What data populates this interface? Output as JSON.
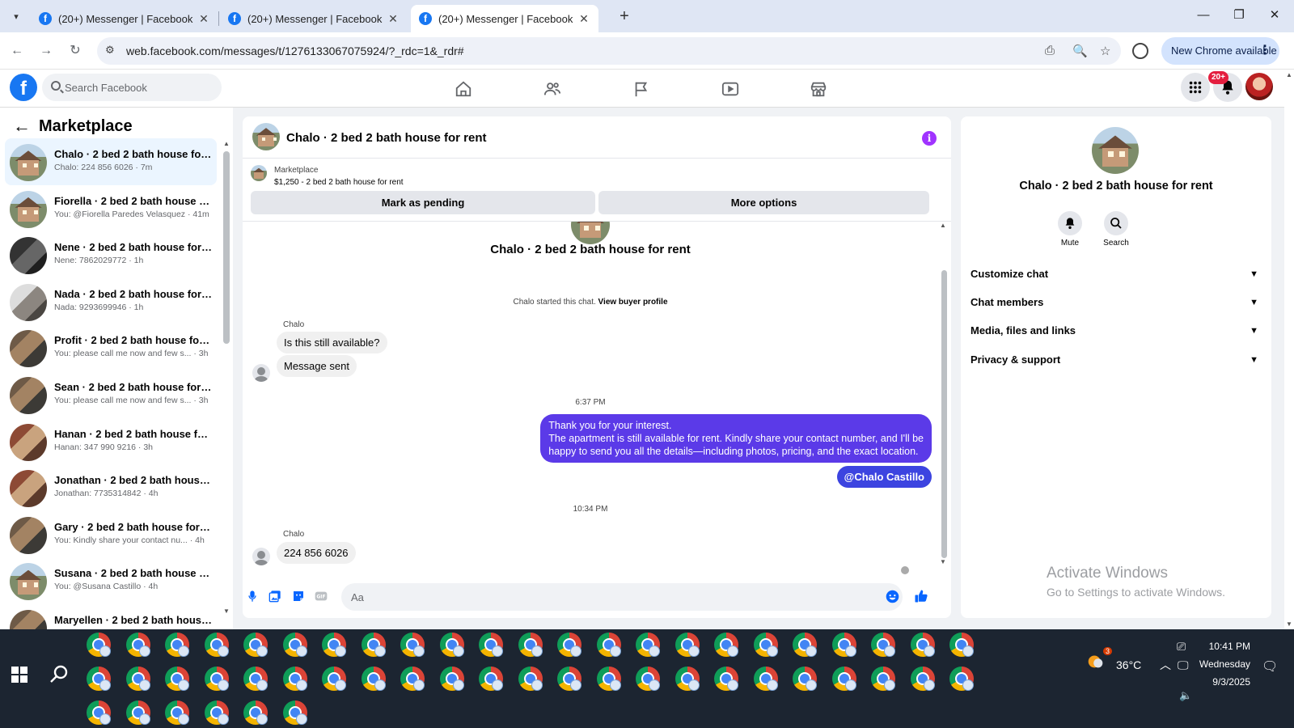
{
  "browser": {
    "tabs": [
      {
        "title": "(20+) Messenger | Facebook",
        "active": false
      },
      {
        "title": "(20+) Messenger | Facebook",
        "active": false
      },
      {
        "title": "(20+) Messenger | Facebook",
        "active": true
      }
    ],
    "url": "web.facebook.com/messages/t/1276133067075924/?_rdc=1&_rdr#",
    "new_chrome_label": "New Chrome available"
  },
  "facebook": {
    "search_placeholder": "Search Facebook",
    "notification_badge": "20+",
    "brand_color": "#1877f2"
  },
  "sidebar": {
    "title": "Marketplace",
    "chats": [
      {
        "title": "Chalo · 2 bed 2 bath house for r...",
        "subtitle": "Chalo: 224 856 6026 · 7m",
        "thumb": "house",
        "selected": true
      },
      {
        "title": "Fiorella · 2 bed 2 bath house for...",
        "subtitle": "You: @Fiorella Paredes Velasquez · 41m",
        "thumb": "house"
      },
      {
        "title": "Nene · 2 bed 2 bath house for r...",
        "subtitle": "Nene: 7862029772 · 1h",
        "thumb": "dark"
      },
      {
        "title": "Nada · 2 bed 2 bath house for r...",
        "subtitle": "Nada: 9293699946 · 1h",
        "thumb": "light"
      },
      {
        "title": "Profit · 2 bed 2 bath house for r...",
        "subtitle": "You: please call me now and few s... · 3h",
        "thumb": "room"
      },
      {
        "title": "Sean · 2 bed 2 bath house for re...",
        "subtitle": "You: please call me now and few s... · 3h",
        "thumb": "room"
      },
      {
        "title": "Hanan · 2 bed 2 bath house for ...",
        "subtitle": "Hanan: 347 990 9216 · 3h",
        "thumb": "brick"
      },
      {
        "title": "Jonathan · 2 bed 2 bath house f...",
        "subtitle": "Jonathan: 7735314842 · 4h",
        "thumb": "brick"
      },
      {
        "title": "Gary · 2 bed 2 bath house for re...",
        "subtitle": "You: Kindly share your contact nu... · 4h",
        "thumb": "room"
      },
      {
        "title": "Susana · 2 bed 2 bath house for...",
        "subtitle": "You: @Susana Castillo · 4h",
        "thumb": "house"
      },
      {
        "title": "Maryellen · 2 bed 2 bath house ...",
        "subtitle": "",
        "thumb": "room"
      }
    ]
  },
  "conversation": {
    "title": "Chalo · 2 bed 2 bath house for rent",
    "listing_source": "Marketplace",
    "listing_detail": "$1,250 - 2 bed 2 bath house for rent",
    "mark_pending_label": "Mark as pending",
    "more_options_label": "More options",
    "started_text": "Chalo started this chat.",
    "view_profile_label": "View buyer profile",
    "sender_name": "Chalo",
    "msg_1": "Is this still available?",
    "msg_2": "Message sent",
    "time_1": "6:37 PM",
    "reply_line1": "Thank you for your interest.",
    "reply_line2": "The apartment is still available for rent. Kindly share your contact number, and I'll be",
    "reply_line3": "happy to send you all the details—including photos, pricing, and the exact location.",
    "mention": "@Chalo Castillo",
    "time_2": "10:34 PM",
    "msg_3": "224 856 6026",
    "composer_placeholder": "Aa",
    "outgoing_color": "#5b3ae8"
  },
  "info_panel": {
    "name": "Chalo · 2 bed 2 bath house for rent",
    "mute_label": "Mute",
    "search_label": "Search",
    "sections": [
      "Customize chat",
      "Chat members",
      "Media, files and links",
      "Privacy & support"
    ]
  },
  "watermark": {
    "line1": "Activate Windows",
    "line2": "Go to Settings to activate Windows."
  },
  "taskbar": {
    "weather": "36°C",
    "time": "10:41 PM",
    "day": "Wednesday",
    "date": "9/3/2025",
    "weather_badge": "3"
  }
}
